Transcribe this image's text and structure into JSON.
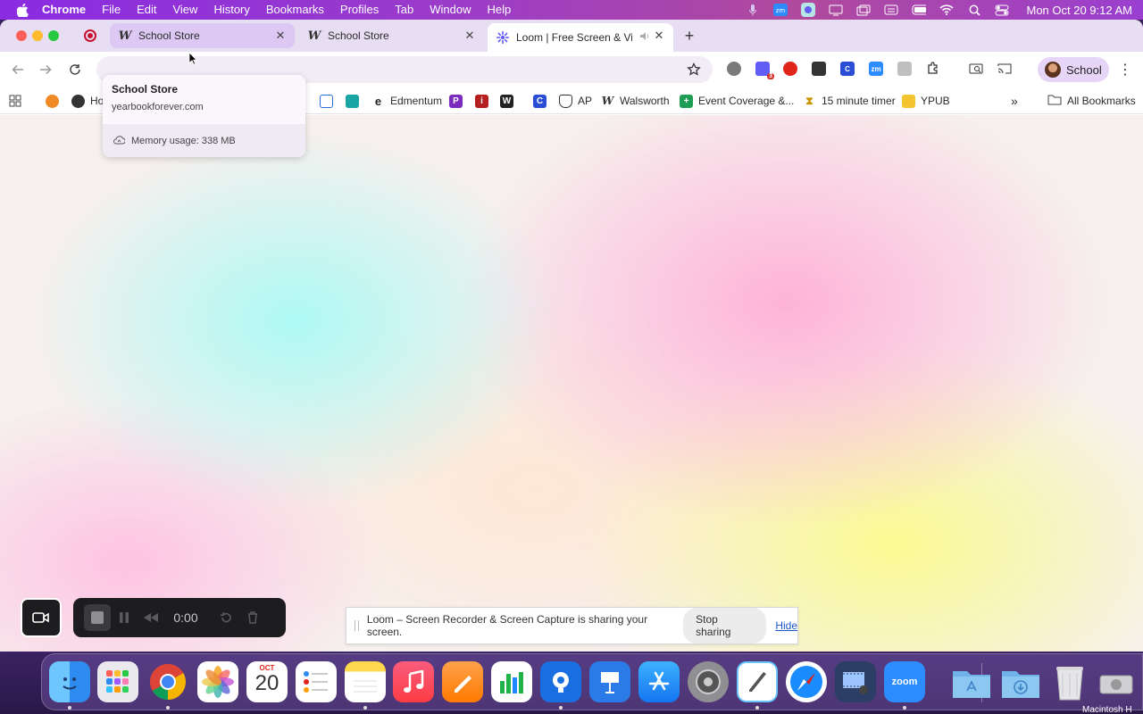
{
  "menubar": {
    "app_name": "Chrome",
    "items": [
      "File",
      "Edit",
      "View",
      "History",
      "Bookmarks",
      "Profiles",
      "Tab",
      "Window",
      "Help"
    ],
    "clock": "Mon Oct 20  9:12 AM"
  },
  "tabs": [
    {
      "title": "School Store",
      "favicon": "W",
      "state": "hovered"
    },
    {
      "title": "School Store",
      "favicon": "W",
      "state": "inactive"
    },
    {
      "title": "Loom | Free Screen & Vid",
      "favicon": "loom-icon",
      "state": "active",
      "audio": true
    }
  ],
  "hovercard": {
    "title": "School Store",
    "url": "yearbookforever.com",
    "memory": "Memory usage: 338 MB"
  },
  "profile": {
    "label": "School"
  },
  "bookmarks": {
    "items": [
      {
        "label": "Ho",
        "icon": "google-icon"
      },
      {
        "label": "Edmentum",
        "icon": "edmentum-icon"
      },
      {
        "label": "AP",
        "icon": "shield-icon"
      },
      {
        "label": "Walsworth",
        "icon": "walsworth-icon"
      },
      {
        "label": "Event Coverage &...",
        "icon": "sheets-icon"
      },
      {
        "label": "15 minute timer",
        "icon": "timer-icon"
      },
      {
        "label": "YPUB",
        "icon": "folder-icon"
      }
    ],
    "all_bookmarks": "All Bookmarks",
    "overflow": "»"
  },
  "loom": {
    "time": "0:00"
  },
  "share_banner": {
    "message": "Loom – Screen Recorder & Screen Capture is sharing your screen.",
    "stop": "Stop sharing",
    "hide": "Hide"
  },
  "calendar": {
    "month": "OCT",
    "day": "20"
  },
  "dock_apps": [
    "Finder",
    "Launchpad",
    "Chrome",
    "Photos",
    "Calendar",
    "Reminders",
    "Notes",
    "Music",
    "Pages",
    "Numbers",
    "Keynote Live",
    "Keynote",
    "App Store",
    "System Settings",
    "TextEdit",
    "Safari",
    "Photo Booth Video",
    "Zoom",
    "Applications",
    "Downloads",
    "Trash"
  ],
  "zoom_label": "zoom",
  "disk_label": "Macintosh H",
  "colors": {
    "accent": "#9b3cc9",
    "tab_active": "#dcc8f2",
    "tabstrip": "#e8def4"
  }
}
